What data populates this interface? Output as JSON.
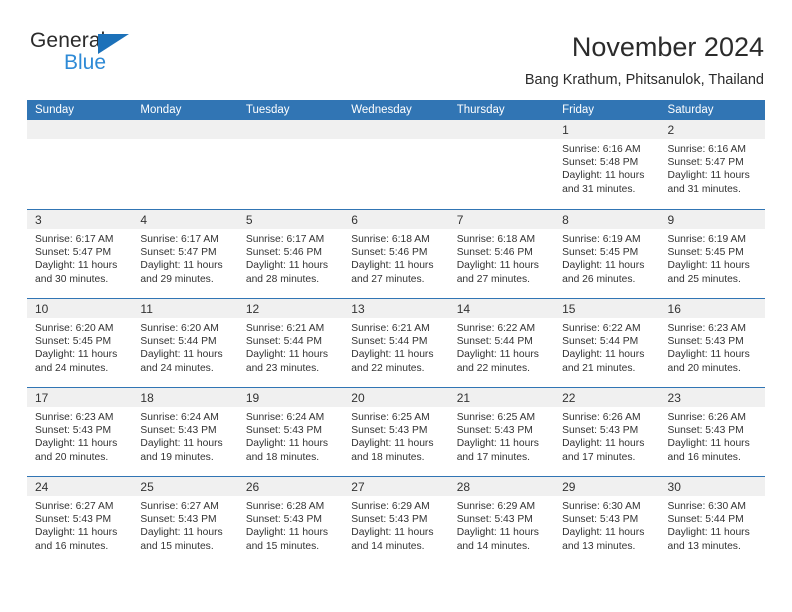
{
  "logo": {
    "word_top": "General",
    "word_bottom": "Blue",
    "triangle_icon": "triangle-icon",
    "color_dark": "#2b2b2b",
    "color_blue": "#2e8ad6",
    "color_triangle": "#1c71b9"
  },
  "header": {
    "title": "November 2024",
    "subtitle": "Bang Krathum, Phitsanulok, Thailand"
  },
  "theme": {
    "header_blue": "#3175b4",
    "daynum_band": "#f0f0f0",
    "text": "#333333"
  },
  "weekdays": [
    "Sunday",
    "Monday",
    "Tuesday",
    "Wednesday",
    "Thursday",
    "Friday",
    "Saturday"
  ],
  "weeks": [
    [
      {
        "day": "",
        "lines": []
      },
      {
        "day": "",
        "lines": []
      },
      {
        "day": "",
        "lines": []
      },
      {
        "day": "",
        "lines": []
      },
      {
        "day": "",
        "lines": []
      },
      {
        "day": "1",
        "lines": [
          "Sunrise: 6:16 AM",
          "Sunset: 5:48 PM",
          "Daylight: 11 hours",
          "and 31 minutes."
        ]
      },
      {
        "day": "2",
        "lines": [
          "Sunrise: 6:16 AM",
          "Sunset: 5:47 PM",
          "Daylight: 11 hours",
          "and 31 minutes."
        ]
      }
    ],
    [
      {
        "day": "3",
        "lines": [
          "Sunrise: 6:17 AM",
          "Sunset: 5:47 PM",
          "Daylight: 11 hours",
          "and 30 minutes."
        ]
      },
      {
        "day": "4",
        "lines": [
          "Sunrise: 6:17 AM",
          "Sunset: 5:47 PM",
          "Daylight: 11 hours",
          "and 29 minutes."
        ]
      },
      {
        "day": "5",
        "lines": [
          "Sunrise: 6:17 AM",
          "Sunset: 5:46 PM",
          "Daylight: 11 hours",
          "and 28 minutes."
        ]
      },
      {
        "day": "6",
        "lines": [
          "Sunrise: 6:18 AM",
          "Sunset: 5:46 PM",
          "Daylight: 11 hours",
          "and 27 minutes."
        ]
      },
      {
        "day": "7",
        "lines": [
          "Sunrise: 6:18 AM",
          "Sunset: 5:46 PM",
          "Daylight: 11 hours",
          "and 27 minutes."
        ]
      },
      {
        "day": "8",
        "lines": [
          "Sunrise: 6:19 AM",
          "Sunset: 5:45 PM",
          "Daylight: 11 hours",
          "and 26 minutes."
        ]
      },
      {
        "day": "9",
        "lines": [
          "Sunrise: 6:19 AM",
          "Sunset: 5:45 PM",
          "Daylight: 11 hours",
          "and 25 minutes."
        ]
      }
    ],
    [
      {
        "day": "10",
        "lines": [
          "Sunrise: 6:20 AM",
          "Sunset: 5:45 PM",
          "Daylight: 11 hours",
          "and 24 minutes."
        ]
      },
      {
        "day": "11",
        "lines": [
          "Sunrise: 6:20 AM",
          "Sunset: 5:44 PM",
          "Daylight: 11 hours",
          "and 24 minutes."
        ]
      },
      {
        "day": "12",
        "lines": [
          "Sunrise: 6:21 AM",
          "Sunset: 5:44 PM",
          "Daylight: 11 hours",
          "and 23 minutes."
        ]
      },
      {
        "day": "13",
        "lines": [
          "Sunrise: 6:21 AM",
          "Sunset: 5:44 PM",
          "Daylight: 11 hours",
          "and 22 minutes."
        ]
      },
      {
        "day": "14",
        "lines": [
          "Sunrise: 6:22 AM",
          "Sunset: 5:44 PM",
          "Daylight: 11 hours",
          "and 22 minutes."
        ]
      },
      {
        "day": "15",
        "lines": [
          "Sunrise: 6:22 AM",
          "Sunset: 5:44 PM",
          "Daylight: 11 hours",
          "and 21 minutes."
        ]
      },
      {
        "day": "16",
        "lines": [
          "Sunrise: 6:23 AM",
          "Sunset: 5:43 PM",
          "Daylight: 11 hours",
          "and 20 minutes."
        ]
      }
    ],
    [
      {
        "day": "17",
        "lines": [
          "Sunrise: 6:23 AM",
          "Sunset: 5:43 PM",
          "Daylight: 11 hours",
          "and 20 minutes."
        ]
      },
      {
        "day": "18",
        "lines": [
          "Sunrise: 6:24 AM",
          "Sunset: 5:43 PM",
          "Daylight: 11 hours",
          "and 19 minutes."
        ]
      },
      {
        "day": "19",
        "lines": [
          "Sunrise: 6:24 AM",
          "Sunset: 5:43 PM",
          "Daylight: 11 hours",
          "and 18 minutes."
        ]
      },
      {
        "day": "20",
        "lines": [
          "Sunrise: 6:25 AM",
          "Sunset: 5:43 PM",
          "Daylight: 11 hours",
          "and 18 minutes."
        ]
      },
      {
        "day": "21",
        "lines": [
          "Sunrise: 6:25 AM",
          "Sunset: 5:43 PM",
          "Daylight: 11 hours",
          "and 17 minutes."
        ]
      },
      {
        "day": "22",
        "lines": [
          "Sunrise: 6:26 AM",
          "Sunset: 5:43 PM",
          "Daylight: 11 hours",
          "and 17 minutes."
        ]
      },
      {
        "day": "23",
        "lines": [
          "Sunrise: 6:26 AM",
          "Sunset: 5:43 PM",
          "Daylight: 11 hours",
          "and 16 minutes."
        ]
      }
    ],
    [
      {
        "day": "24",
        "lines": [
          "Sunrise: 6:27 AM",
          "Sunset: 5:43 PM",
          "Daylight: 11 hours",
          "and 16 minutes."
        ]
      },
      {
        "day": "25",
        "lines": [
          "Sunrise: 6:27 AM",
          "Sunset: 5:43 PM",
          "Daylight: 11 hours",
          "and 15 minutes."
        ]
      },
      {
        "day": "26",
        "lines": [
          "Sunrise: 6:28 AM",
          "Sunset: 5:43 PM",
          "Daylight: 11 hours",
          "and 15 minutes."
        ]
      },
      {
        "day": "27",
        "lines": [
          "Sunrise: 6:29 AM",
          "Sunset: 5:43 PM",
          "Daylight: 11 hours",
          "and 14 minutes."
        ]
      },
      {
        "day": "28",
        "lines": [
          "Sunrise: 6:29 AM",
          "Sunset: 5:43 PM",
          "Daylight: 11 hours",
          "and 14 minutes."
        ]
      },
      {
        "day": "29",
        "lines": [
          "Sunrise: 6:30 AM",
          "Sunset: 5:43 PM",
          "Daylight: 11 hours",
          "and 13 minutes."
        ]
      },
      {
        "day": "30",
        "lines": [
          "Sunrise: 6:30 AM",
          "Sunset: 5:44 PM",
          "Daylight: 11 hours",
          "and 13 minutes."
        ]
      }
    ]
  ]
}
